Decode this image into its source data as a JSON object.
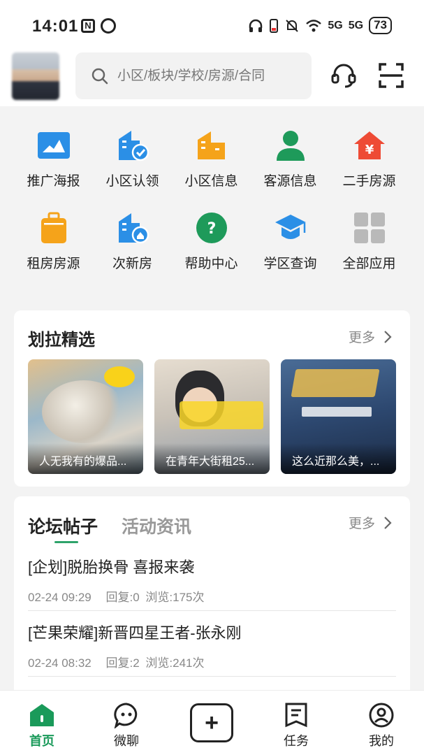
{
  "status": {
    "time": "14:01",
    "battery": "73",
    "signal1": "5G",
    "signal2": "5G"
  },
  "header": {
    "search_placeholder": "小区/板块/学校/房源/合同"
  },
  "grid": [
    {
      "label": "推广海报",
      "icon": "poster-icon",
      "color": "#2b8fe6"
    },
    {
      "label": "小区认领",
      "icon": "building-check-icon",
      "color": "#2b8fe6"
    },
    {
      "label": "小区信息",
      "icon": "building-icon",
      "color": "#f5a31a"
    },
    {
      "label": "客源信息",
      "icon": "person-icon",
      "color": "#1e9a5a"
    },
    {
      "label": "二手房源",
      "icon": "house-yen-icon",
      "color": "#ee4b35"
    },
    {
      "label": "租房房源",
      "icon": "suitcase-icon",
      "color": "#f5a31a"
    },
    {
      "label": "次新房",
      "icon": "building-new-icon",
      "color": "#2b8fe6"
    },
    {
      "label": "帮助中心",
      "icon": "help-icon",
      "color": "#1e9a5a"
    },
    {
      "label": "学区查询",
      "icon": "graduation-cap-icon",
      "color": "#2b8fe6"
    },
    {
      "label": "全部应用",
      "icon": "apps-grid-icon",
      "color": "#b9b9b9"
    }
  ],
  "featured": {
    "title": "划拉精选",
    "more": "更多",
    "items": [
      {
        "caption": "人无我有的爆品..."
      },
      {
        "caption": "在青年大街租25..."
      },
      {
        "caption": "这么近那么美，..."
      }
    ]
  },
  "forum": {
    "tabs": [
      "论坛帖子",
      "活动资讯"
    ],
    "more": "更多",
    "posts": [
      {
        "title": "[企划]脱胎换骨 喜报来袭",
        "time": "02-24 09:29",
        "replies": "回复:0",
        "views": "浏览:175次"
      },
      {
        "title": "[芒果荣耀]新晋四星王者-张永刚",
        "time": "02-24 08:32",
        "replies": "回复:2",
        "views": "浏览:241次"
      }
    ]
  },
  "nav": [
    {
      "label": "首页",
      "icon": "home-icon"
    },
    {
      "label": "微聊",
      "icon": "chat-icon"
    },
    {
      "label": "",
      "icon": "add-icon"
    },
    {
      "label": "任务",
      "icon": "task-icon"
    },
    {
      "label": "我的",
      "icon": "profile-icon"
    }
  ],
  "colors": {
    "accent": "#1a9a5a"
  }
}
